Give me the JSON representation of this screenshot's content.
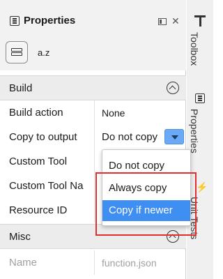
{
  "panel": {
    "title": "Properties",
    "sort_label": "a.z"
  },
  "sections": {
    "build": "Build",
    "misc": "Misc"
  },
  "rows": [
    {
      "name": "Build action",
      "value": "None"
    },
    {
      "name": "Copy to output",
      "value": "Do not copy"
    },
    {
      "name": "Custom Tool",
      "value": ""
    },
    {
      "name": "Custom Tool Na",
      "value": ""
    },
    {
      "name": "Resource ID",
      "value": ""
    }
  ],
  "misc_rows": [
    {
      "name": "Name",
      "value": "function.json"
    }
  ],
  "dropdown": {
    "options": [
      "Do not copy",
      "Always copy",
      "Copy if newer"
    ],
    "selected": "Copy if newer"
  },
  "side_tabs": {
    "toolbox": "Toolbox",
    "properties": "Properties",
    "unit_tests": "Unit Tests"
  },
  "colors": {
    "selection": "#3f8ef2",
    "highlight_border": "#e0302d"
  }
}
